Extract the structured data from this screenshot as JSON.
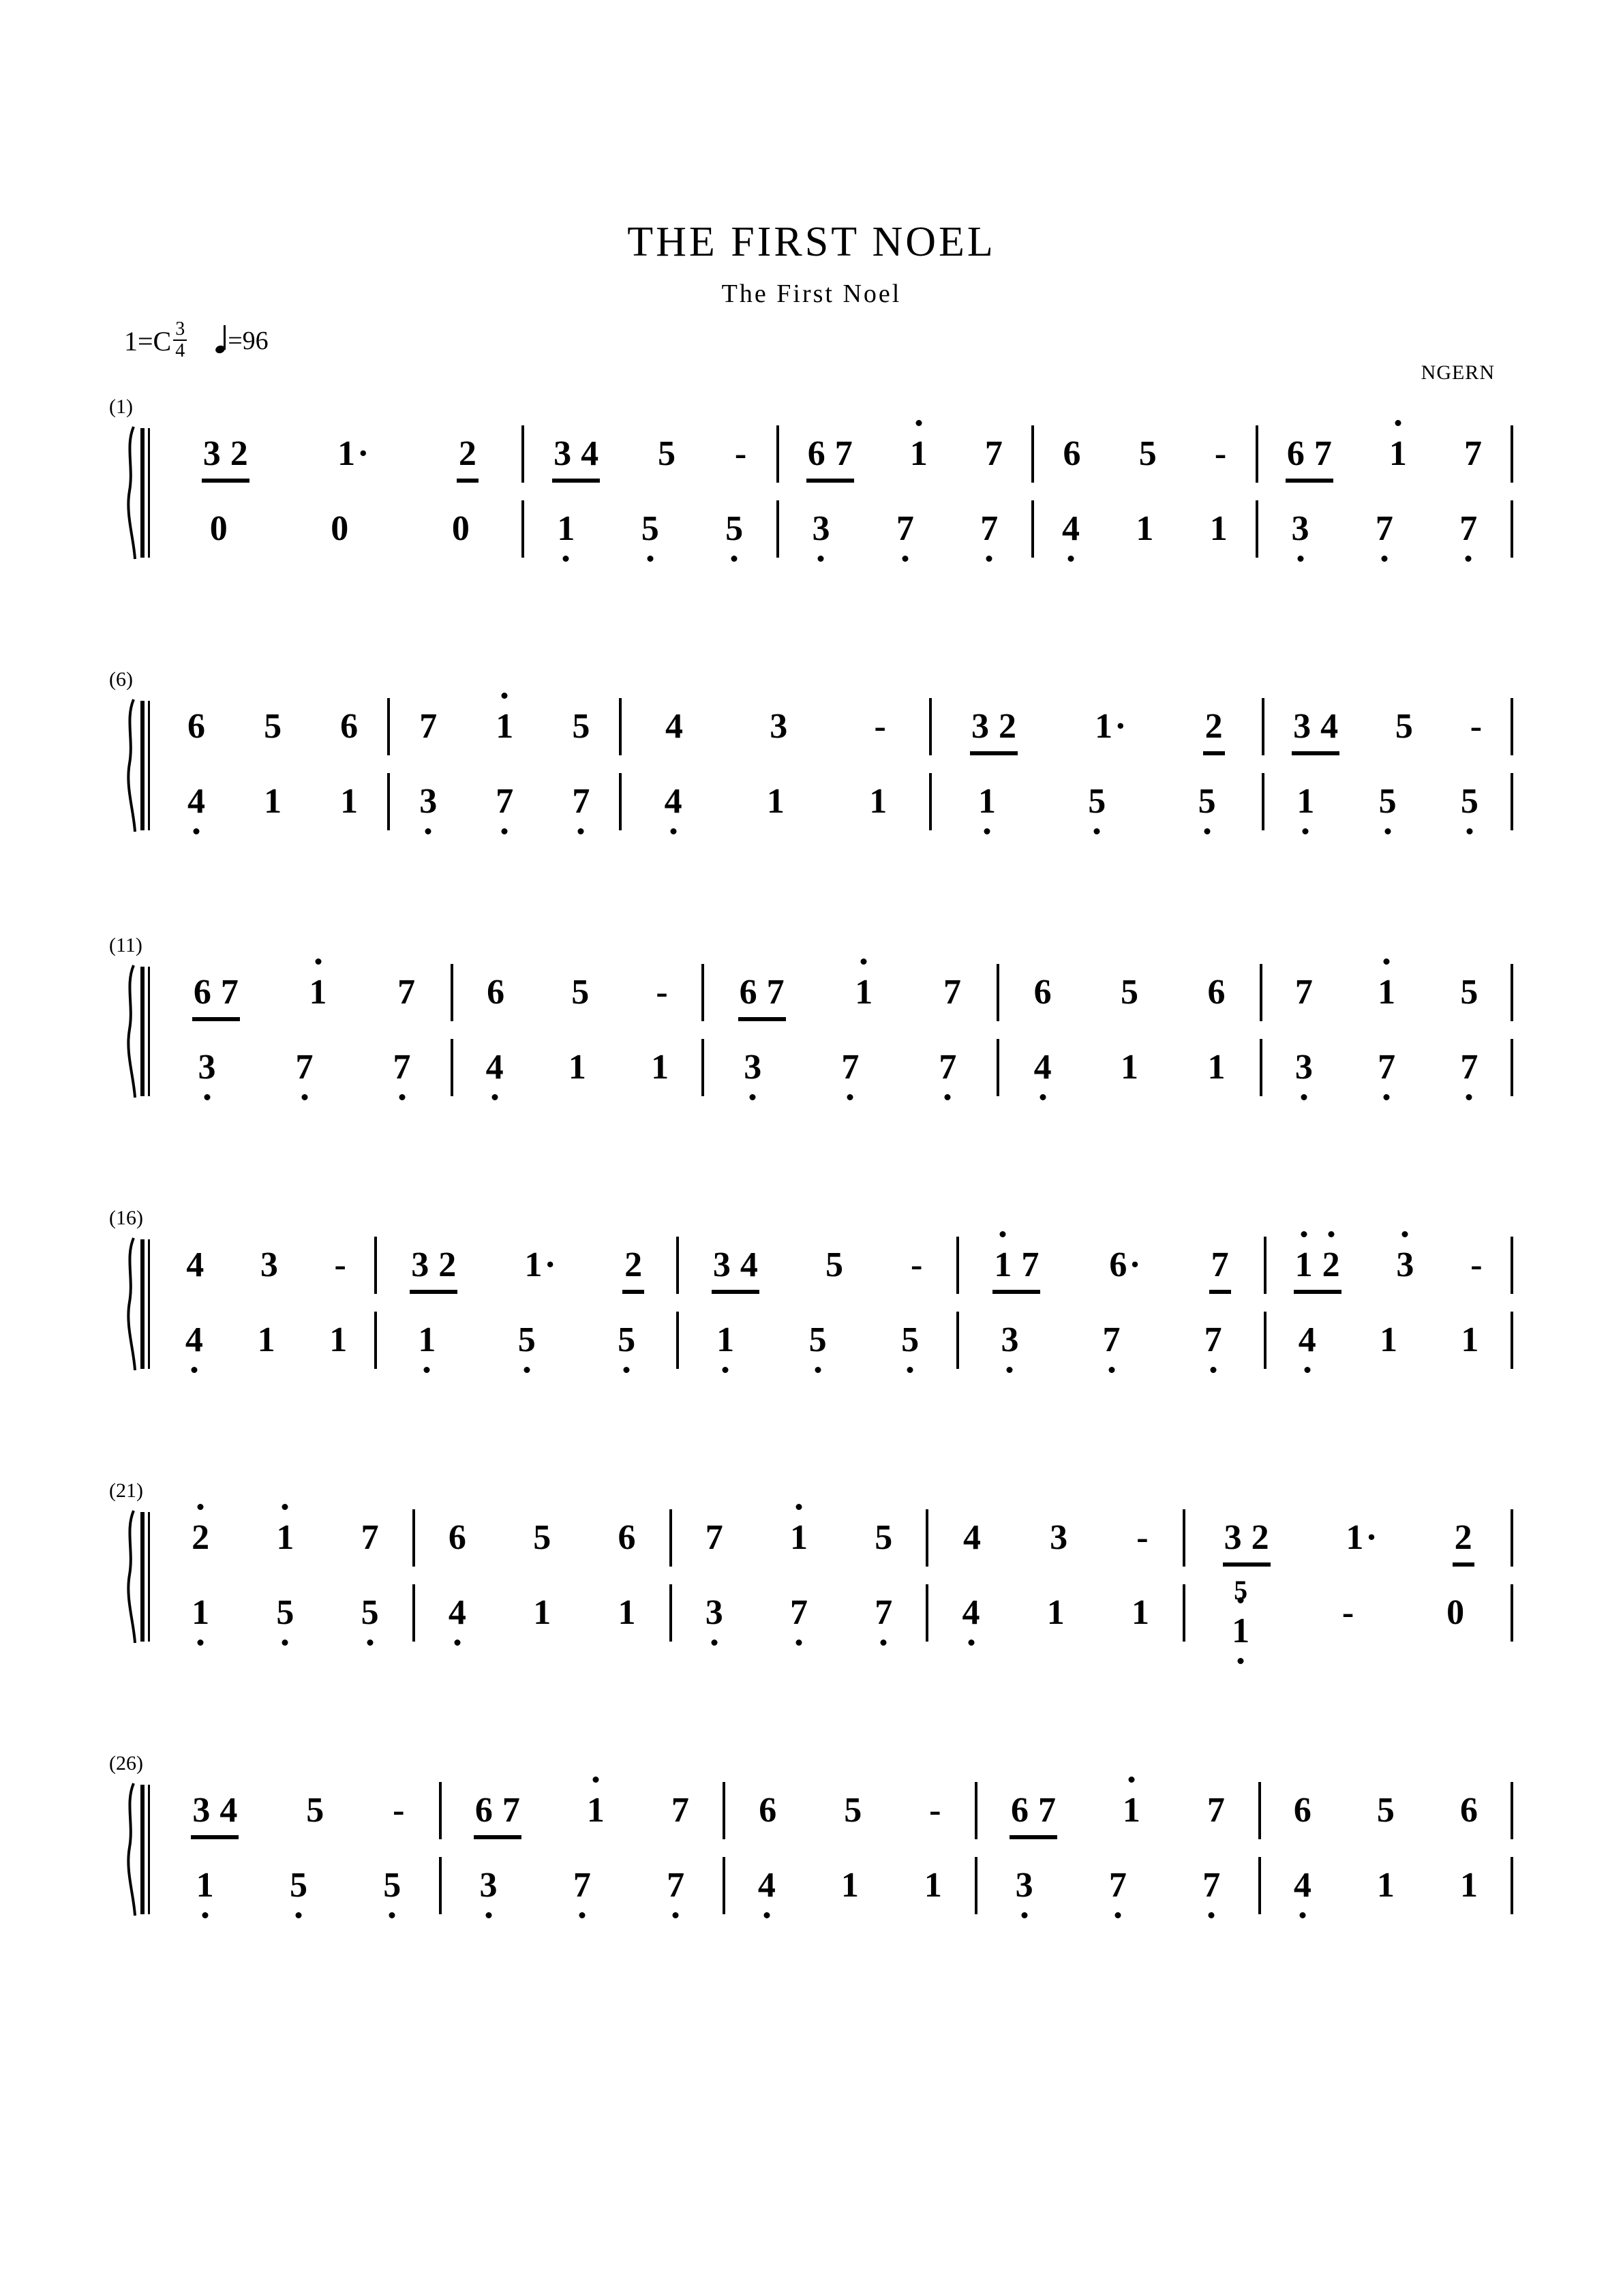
{
  "header": {
    "title": "THE FIRST NOEL",
    "subtitle": "The First Noel",
    "composer": "NGERN",
    "key_label": "1=C",
    "time_num": "3",
    "time_den": "4",
    "tempo_eq": "=96",
    "tempo_note_icon": "quarter-note-icon"
  },
  "notation": {
    "type": "jianpu",
    "systems": [
      {
        "measure_number": "(1)",
        "upper": [
          {
            "notes": [
              {
                "t": "3",
                "beam": "start"
              },
              {
                "t": "2",
                "beam": "end"
              },
              {
                "t": "1",
                "dot": true
              },
              {
                "t": "2",
                "beam16": true
              }
            ]
          },
          {
            "notes": [
              {
                "t": "3",
                "beam": "start"
              },
              {
                "t": "4",
                "beam": "end"
              },
              {
                "t": "5"
              },
              {
                "t": "-"
              }
            ]
          },
          {
            "notes": [
              {
                "t": "6",
                "beam": "start"
              },
              {
                "t": "7",
                "beam": "end"
              },
              {
                "t": "1",
                "oct": "up"
              },
              {
                "t": "7"
              }
            ]
          },
          {
            "notes": [
              {
                "t": "6"
              },
              {
                "t": "5"
              },
              {
                "t": "-"
              }
            ]
          },
          {
            "notes": [
              {
                "t": "6",
                "beam": "start"
              },
              {
                "t": "7",
                "beam": "end"
              },
              {
                "t": "1",
                "oct": "up"
              },
              {
                "t": "7"
              }
            ]
          }
        ],
        "lower": [
          {
            "notes": [
              {
                "t": "0"
              },
              {
                "t": "0"
              },
              {
                "t": "0"
              }
            ]
          },
          {
            "notes": [
              {
                "t": "1",
                "oct": "down"
              },
              {
                "t": "5",
                "oct": "down"
              },
              {
                "t": "5",
                "oct": "down"
              }
            ]
          },
          {
            "notes": [
              {
                "t": "3",
                "oct": "down"
              },
              {
                "t": "7",
                "oct": "down"
              },
              {
                "t": "7",
                "oct": "down"
              }
            ]
          },
          {
            "notes": [
              {
                "t": "4",
                "oct": "down"
              },
              {
                "t": "1"
              },
              {
                "t": "1"
              }
            ]
          },
          {
            "notes": [
              {
                "t": "3",
                "oct": "down"
              },
              {
                "t": "7",
                "oct": "down"
              },
              {
                "t": "7",
                "oct": "down"
              }
            ]
          }
        ]
      },
      {
        "measure_number": "(6)",
        "upper": [
          {
            "notes": [
              {
                "t": "6"
              },
              {
                "t": "5"
              },
              {
                "t": "6"
              }
            ]
          },
          {
            "notes": [
              {
                "t": "7"
              },
              {
                "t": "1",
                "oct": "up"
              },
              {
                "t": "5"
              }
            ]
          },
          {
            "notes": [
              {
                "t": "4"
              },
              {
                "t": "3"
              },
              {
                "t": "-"
              }
            ]
          },
          {
            "notes": [
              {
                "t": "3",
                "beam": "start"
              },
              {
                "t": "2",
                "beam": "end"
              },
              {
                "t": "1",
                "dot": true
              },
              {
                "t": "2",
                "beam16": true
              }
            ]
          },
          {
            "notes": [
              {
                "t": "3",
                "beam": "start"
              },
              {
                "t": "4",
                "beam": "end"
              },
              {
                "t": "5"
              },
              {
                "t": "-"
              }
            ]
          }
        ],
        "lower": [
          {
            "notes": [
              {
                "t": "4",
                "oct": "down"
              },
              {
                "t": "1"
              },
              {
                "t": "1"
              }
            ]
          },
          {
            "notes": [
              {
                "t": "3",
                "oct": "down"
              },
              {
                "t": "7",
                "oct": "down"
              },
              {
                "t": "7",
                "oct": "down"
              }
            ]
          },
          {
            "notes": [
              {
                "t": "4",
                "oct": "down"
              },
              {
                "t": "1"
              },
              {
                "t": "1"
              }
            ]
          },
          {
            "notes": [
              {
                "t": "1",
                "oct": "down"
              },
              {
                "t": "5",
                "oct": "down"
              },
              {
                "t": "5",
                "oct": "down"
              }
            ]
          },
          {
            "notes": [
              {
                "t": "1",
                "oct": "down"
              },
              {
                "t": "5",
                "oct": "down"
              },
              {
                "t": "5",
                "oct": "down"
              }
            ]
          }
        ]
      },
      {
        "measure_number": "(11)",
        "upper": [
          {
            "notes": [
              {
                "t": "6",
                "beam": "start"
              },
              {
                "t": "7",
                "beam": "end"
              },
              {
                "t": "1",
                "oct": "up"
              },
              {
                "t": "7"
              }
            ]
          },
          {
            "notes": [
              {
                "t": "6"
              },
              {
                "t": "5"
              },
              {
                "t": "-"
              }
            ]
          },
          {
            "notes": [
              {
                "t": "6",
                "beam": "start"
              },
              {
                "t": "7",
                "beam": "end"
              },
              {
                "t": "1",
                "oct": "up"
              },
              {
                "t": "7"
              }
            ]
          },
          {
            "notes": [
              {
                "t": "6"
              },
              {
                "t": "5"
              },
              {
                "t": "6"
              }
            ]
          },
          {
            "notes": [
              {
                "t": "7"
              },
              {
                "t": "1",
                "oct": "up"
              },
              {
                "t": "5"
              }
            ]
          }
        ],
        "lower": [
          {
            "notes": [
              {
                "t": "3",
                "oct": "down"
              },
              {
                "t": "7",
                "oct": "down"
              },
              {
                "t": "7",
                "oct": "down"
              }
            ]
          },
          {
            "notes": [
              {
                "t": "4",
                "oct": "down"
              },
              {
                "t": "1"
              },
              {
                "t": "1"
              }
            ]
          },
          {
            "notes": [
              {
                "t": "3",
                "oct": "down"
              },
              {
                "t": "7",
                "oct": "down"
              },
              {
                "t": "7",
                "oct": "down"
              }
            ]
          },
          {
            "notes": [
              {
                "t": "4",
                "oct": "down"
              },
              {
                "t": "1"
              },
              {
                "t": "1"
              }
            ]
          },
          {
            "notes": [
              {
                "t": "3",
                "oct": "down"
              },
              {
                "t": "7",
                "oct": "down"
              },
              {
                "t": "7",
                "oct": "down"
              }
            ]
          }
        ]
      },
      {
        "measure_number": "(16)",
        "upper": [
          {
            "notes": [
              {
                "t": "4"
              },
              {
                "t": "3"
              },
              {
                "t": "-"
              }
            ]
          },
          {
            "notes": [
              {
                "t": "3",
                "beam": "start"
              },
              {
                "t": "2",
                "beam": "end"
              },
              {
                "t": "1",
                "dot": true
              },
              {
                "t": "2",
                "beam16": true
              }
            ]
          },
          {
            "notes": [
              {
                "t": "3",
                "beam": "start"
              },
              {
                "t": "4",
                "beam": "end"
              },
              {
                "t": "5"
              },
              {
                "t": "-"
              }
            ]
          },
          {
            "notes": [
              {
                "t": "1",
                "oct": "up",
                "beam": "start"
              },
              {
                "t": "7",
                "beam": "end"
              },
              {
                "t": "6",
                "dot": true
              },
              {
                "t": "7",
                "beam16": true
              }
            ]
          },
          {
            "notes": [
              {
                "t": "1",
                "oct": "up",
                "beam": "start"
              },
              {
                "t": "2",
                "oct": "up",
                "beam": "end"
              },
              {
                "t": "3",
                "oct": "up"
              },
              {
                "t": "-"
              }
            ]
          }
        ],
        "lower": [
          {
            "notes": [
              {
                "t": "4",
                "oct": "down"
              },
              {
                "t": "1"
              },
              {
                "t": "1"
              }
            ]
          },
          {
            "notes": [
              {
                "t": "1",
                "oct": "down"
              },
              {
                "t": "5",
                "oct": "down"
              },
              {
                "t": "5",
                "oct": "down"
              }
            ]
          },
          {
            "notes": [
              {
                "t": "1",
                "oct": "down"
              },
              {
                "t": "5",
                "oct": "down"
              },
              {
                "t": "5",
                "oct": "down"
              }
            ]
          },
          {
            "notes": [
              {
                "t": "3",
                "oct": "down"
              },
              {
                "t": "7",
                "oct": "down"
              },
              {
                "t": "7",
                "oct": "down"
              }
            ]
          },
          {
            "notes": [
              {
                "t": "4",
                "oct": "down"
              },
              {
                "t": "1"
              },
              {
                "t": "1"
              }
            ]
          }
        ]
      },
      {
        "measure_number": "(21)",
        "upper": [
          {
            "notes": [
              {
                "t": "2",
                "oct": "up"
              },
              {
                "t": "1",
                "oct": "up"
              },
              {
                "t": "7"
              }
            ]
          },
          {
            "notes": [
              {
                "t": "6"
              },
              {
                "t": "5"
              },
              {
                "t": "6"
              }
            ]
          },
          {
            "notes": [
              {
                "t": "7"
              },
              {
                "t": "1",
                "oct": "up"
              },
              {
                "t": "5"
              }
            ]
          },
          {
            "notes": [
              {
                "t": "4"
              },
              {
                "t": "3"
              },
              {
                "t": "-"
              }
            ]
          },
          {
            "notes": [
              {
                "t": "3",
                "beam": "start"
              },
              {
                "t": "2",
                "beam": "end"
              },
              {
                "t": "1",
                "dot": true
              },
              {
                "t": "2",
                "beam16": true
              }
            ]
          }
        ],
        "lower": [
          {
            "notes": [
              {
                "t": "1",
                "oct": "down"
              },
              {
                "t": "5",
                "oct": "down"
              },
              {
                "t": "5",
                "oct": "down"
              }
            ]
          },
          {
            "notes": [
              {
                "t": "4",
                "oct": "down"
              },
              {
                "t": "1"
              },
              {
                "t": "1"
              }
            ]
          },
          {
            "notes": [
              {
                "t": "3",
                "oct": "down"
              },
              {
                "t": "7",
                "oct": "down"
              },
              {
                "t": "7",
                "oct": "down"
              }
            ]
          },
          {
            "notes": [
              {
                "t": "4",
                "oct": "down"
              },
              {
                "t": "1"
              },
              {
                "t": "1"
              }
            ]
          },
          {
            "notes": [
              {
                "chord": {
                  "top": "5",
                  "bottom": "1",
                  "bottom_oct": "down",
                  "top_oct_dot": true
                }
              },
              {
                "t": "-"
              },
              {
                "t": "0"
              }
            ]
          }
        ]
      },
      {
        "measure_number": "(26)",
        "upper": [
          {
            "notes": [
              {
                "t": "3",
                "beam": "start"
              },
              {
                "t": "4",
                "beam": "end"
              },
              {
                "t": "5"
              },
              {
                "t": "-"
              }
            ]
          },
          {
            "notes": [
              {
                "t": "6",
                "beam": "start"
              },
              {
                "t": "7",
                "beam": "end"
              },
              {
                "t": "1",
                "oct": "up"
              },
              {
                "t": "7"
              }
            ]
          },
          {
            "notes": [
              {
                "t": "6"
              },
              {
                "t": "5"
              },
              {
                "t": "-"
              }
            ]
          },
          {
            "notes": [
              {
                "t": "6",
                "beam": "start"
              },
              {
                "t": "7",
                "beam": "end"
              },
              {
                "t": "1",
                "oct": "up"
              },
              {
                "t": "7"
              }
            ]
          },
          {
            "notes": [
              {
                "t": "6"
              },
              {
                "t": "5"
              },
              {
                "t": "6"
              }
            ]
          }
        ],
        "lower": [
          {
            "notes": [
              {
                "t": "1",
                "oct": "down"
              },
              {
                "t": "5",
                "oct": "down"
              },
              {
                "t": "5",
                "oct": "down"
              }
            ]
          },
          {
            "notes": [
              {
                "t": "3",
                "oct": "down"
              },
              {
                "t": "7",
                "oct": "down"
              },
              {
                "t": "7",
                "oct": "down"
              }
            ]
          },
          {
            "notes": [
              {
                "t": "4",
                "oct": "down"
              },
              {
                "t": "1"
              },
              {
                "t": "1"
              }
            ]
          },
          {
            "notes": [
              {
                "t": "3",
                "oct": "down"
              },
              {
                "t": "7",
                "oct": "down"
              },
              {
                "t": "7",
                "oct": "down"
              }
            ]
          },
          {
            "notes": [
              {
                "t": "4",
                "oct": "down"
              },
              {
                "t": "1"
              },
              {
                "t": "1"
              }
            ]
          }
        ]
      }
    ]
  }
}
